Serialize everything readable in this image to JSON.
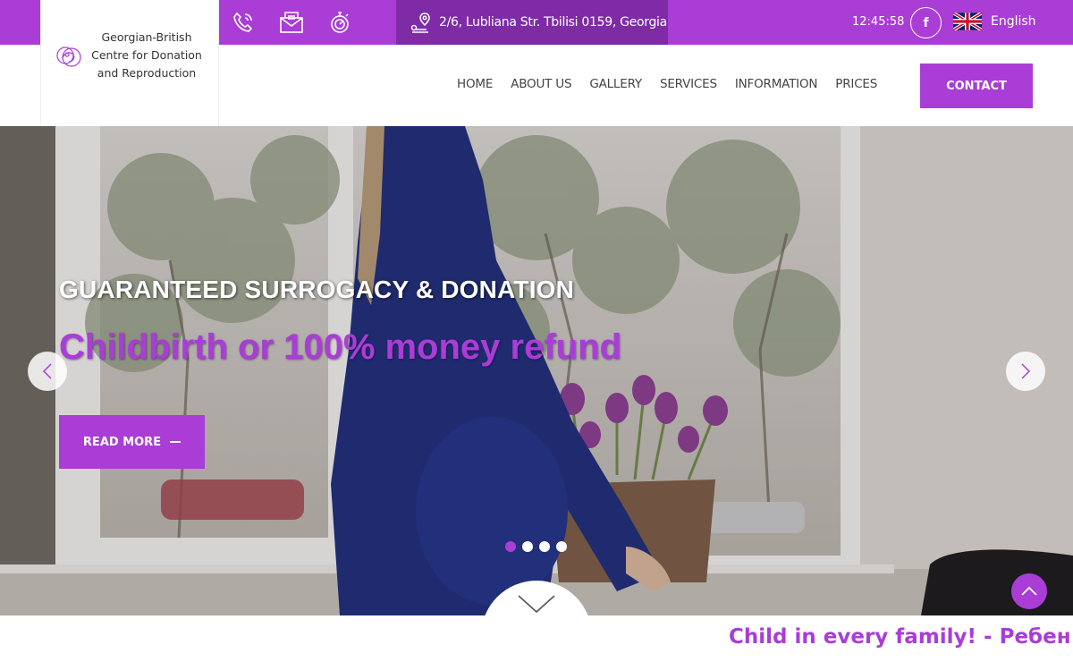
{
  "colors": {
    "accent": "#a93dd6",
    "accent_dark": "#7f2ba6",
    "white": "#ffffff"
  },
  "topbar": {
    "icons": [
      "phone-icon",
      "mail-icon",
      "stopwatch-icon"
    ],
    "address": "2/6, Lubliana Str. Tbilisi 0159, Georgia",
    "time": "12:45:58",
    "facebook_label": "f",
    "language": "English"
  },
  "logo": {
    "line1": "Georgian-British",
    "line2": "Centre for Donation",
    "line3": "and Reproduction"
  },
  "nav": {
    "items": [
      {
        "label": "HOME"
      },
      {
        "label": "ABOUT US"
      },
      {
        "label": "GALLERY"
      },
      {
        "label": "SERVICES"
      },
      {
        "label": "INFORMATION"
      },
      {
        "label": "PRICES"
      }
    ],
    "contact_label": "CONTACT"
  },
  "hero": {
    "subtitle": "GUARANTEED SURROGACY & DONATION",
    "title": "Childbirth or 100% money refund",
    "button_label": "READ MORE",
    "slides": 4,
    "active_slide": 1
  },
  "marquee": {
    "text": "Child in every family! - Ребен"
  }
}
